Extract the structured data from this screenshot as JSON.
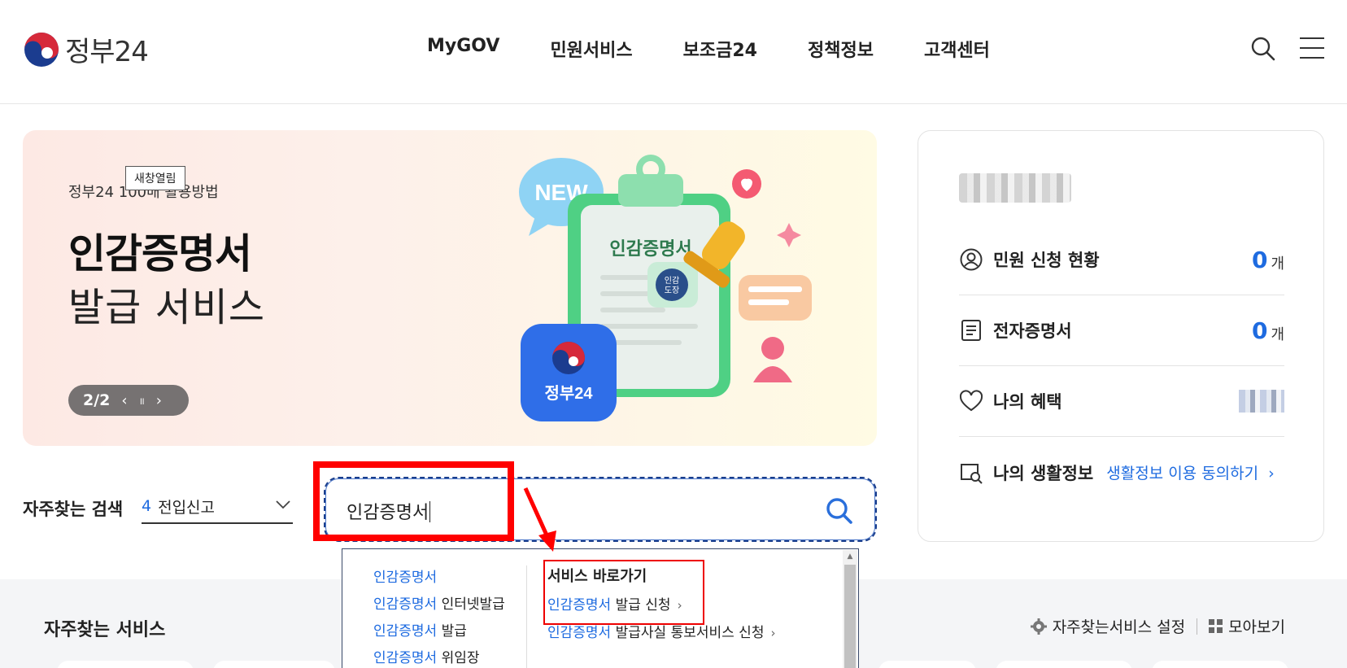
{
  "header": {
    "logo_text": "정부24",
    "nav": [
      "MyGOV",
      "민원서비스",
      "보조금24",
      "정책정보",
      "고객센터"
    ]
  },
  "banner": {
    "tooltip": "새창열림",
    "subtitle": "정부24 100배 활용방법",
    "title_line1": "인감증명서",
    "title_line2": "발급 서비스",
    "pager": "2/2",
    "pager_prev": "‹",
    "pager_pause": "॥",
    "pager_next": "›",
    "art": {
      "bubble": "NEW",
      "clipboard_title": "인감증명서",
      "stamp_line1": "인감",
      "stamp_line2": "도장",
      "app_label": "정부24"
    }
  },
  "panel": {
    "rows": [
      {
        "label": "민원 신청 현황",
        "value": "0",
        "unit": "개"
      },
      {
        "label": "전자증명서",
        "value": "0",
        "unit": "개"
      },
      {
        "label": "나의 혜택"
      },
      {
        "label": "나의 생활정보",
        "link": "생활정보 이용 동의하기",
        "link_arrow": "›"
      }
    ]
  },
  "search": {
    "fav_label": "자주찾는 검색",
    "fav_rank": "4",
    "fav_term": "전입신고",
    "query": "인감증명서"
  },
  "autocomplete": {
    "keyword": "인감증명서",
    "suggestions": [
      {
        "hl": "인감증명서",
        "rest": ""
      },
      {
        "hl": "인감증명서",
        "rest": " 인터넷발급"
      },
      {
        "hl": "인감증명서",
        "rest": " 발급"
      },
      {
        "hl": "인감증명서",
        "rest": " 위임장"
      }
    ],
    "shortcut_heading": "서비스 바로가기",
    "shortcuts": [
      {
        "hl": "인감증명서",
        "rest": " 발급 신청",
        "arrow": "›"
      },
      {
        "hl": "인감증명서",
        "rest": " 발급사실 통보서비스 신청",
        "arrow": "›"
      }
    ]
  },
  "lower": {
    "title": "자주찾는 서비스",
    "settings": "자주찾는서비스 설정",
    "view_all": "모아보기"
  },
  "colors": {
    "accent": "#1e6be0",
    "highlight_red": "#ff0000",
    "search_border": "#1a3e8c"
  }
}
